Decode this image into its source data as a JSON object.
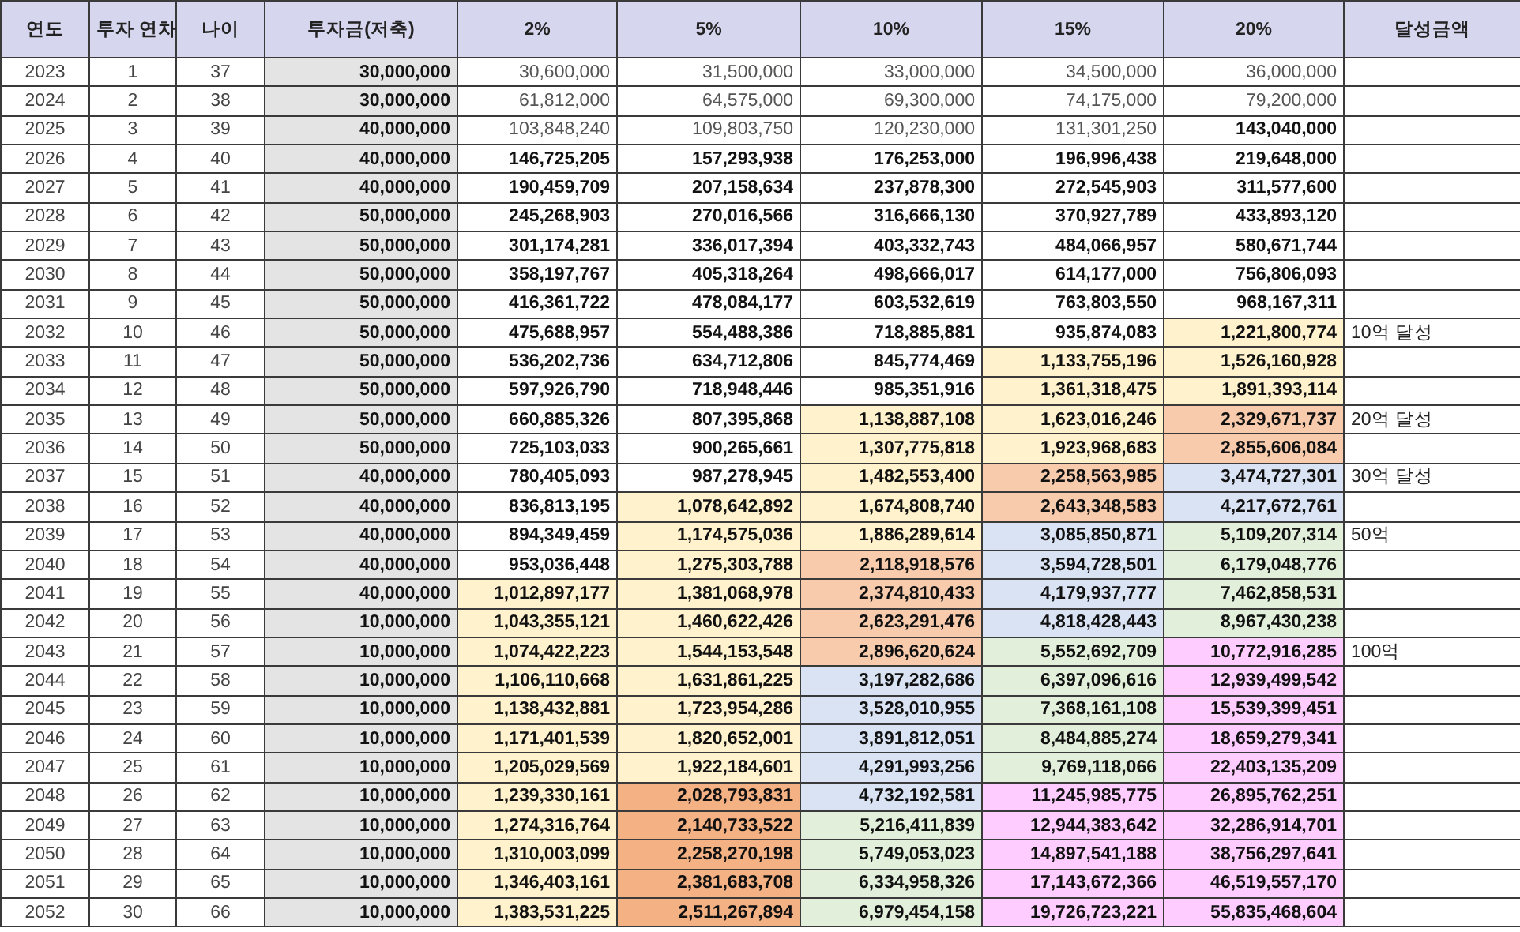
{
  "columns": [
    "연도",
    "투자 연차",
    "나이",
    "투자금(저축)",
    "2%",
    "5%",
    "10%",
    "15%",
    "20%",
    "달성금액"
  ],
  "rows": [
    {
      "year": "2023",
      "period": "1",
      "age": "37",
      "investment": "30,000,000",
      "rates": [
        {
          "text": "30,600,000",
          "muted": true
        },
        {
          "text": "31,500,000",
          "muted": true
        },
        {
          "text": "33,000,000",
          "muted": true
        },
        {
          "text": "34,500,000",
          "muted": true
        },
        {
          "text": "36,000,000",
          "muted": true
        }
      ]
    },
    {
      "year": "2024",
      "period": "2",
      "age": "38",
      "investment": "30,000,000",
      "rates": [
        {
          "text": "61,812,000",
          "muted": true
        },
        {
          "text": "64,575,000",
          "muted": true
        },
        {
          "text": "69,300,000",
          "muted": true
        },
        {
          "text": "74,175,000",
          "muted": true
        },
        {
          "text": "79,200,000",
          "muted": true
        }
      ]
    },
    {
      "year": "2025",
      "period": "3",
      "age": "39",
      "investment": "40,000,000",
      "rates": [
        {
          "text": "103,848,240",
          "muted": true
        },
        {
          "text": "109,803,750",
          "muted": true
        },
        {
          "text": "120,230,000",
          "muted": true
        },
        {
          "text": "131,301,250",
          "muted": true
        },
        {
          "text": "143,040,000",
          "muted": false
        }
      ]
    },
    {
      "year": "2026",
      "period": "4",
      "age": "40",
      "investment": "40,000,000",
      "rates": [
        {
          "text": "146,725,205",
          "muted": false
        },
        {
          "text": "157,293,938",
          "muted": false
        },
        {
          "text": "176,253,000",
          "muted": false
        },
        {
          "text": "196,996,438",
          "muted": false
        },
        {
          "text": "219,648,000",
          "muted": false
        }
      ]
    },
    {
      "year": "2027",
      "period": "5",
      "age": "41",
      "investment": "40,000,000",
      "rates": [
        {
          "text": "190,459,709",
          "muted": false
        },
        {
          "text": "207,158,634",
          "muted": false
        },
        {
          "text": "237,878,300",
          "muted": false
        },
        {
          "text": "272,545,903",
          "muted": false
        },
        {
          "text": "311,577,600",
          "muted": false
        }
      ]
    },
    {
      "year": "2028",
      "period": "6",
      "age": "42",
      "investment": "50,000,000",
      "rates": [
        {
          "text": "245,268,903",
          "muted": false
        },
        {
          "text": "270,016,566",
          "muted": false
        },
        {
          "text": "316,666,130",
          "muted": false
        },
        {
          "text": "370,927,789",
          "muted": false
        },
        {
          "text": "433,893,120",
          "muted": false
        }
      ]
    },
    {
      "year": "2029",
      "period": "7",
      "age": "43",
      "investment": "50,000,000",
      "rates": [
        {
          "text": "301,174,281",
          "muted": false
        },
        {
          "text": "336,017,394",
          "muted": false
        },
        {
          "text": "403,332,743",
          "muted": false
        },
        {
          "text": "484,066,957",
          "muted": false
        },
        {
          "text": "580,671,744",
          "muted": false
        }
      ]
    },
    {
      "year": "2030",
      "period": "8",
      "age": "44",
      "investment": "50,000,000",
      "rates": [
        {
          "text": "358,197,767",
          "muted": false
        },
        {
          "text": "405,318,264",
          "muted": false
        },
        {
          "text": "498,666,017",
          "muted": false
        },
        {
          "text": "614,177,000",
          "muted": false
        },
        {
          "text": "756,806,093",
          "muted": false
        }
      ]
    },
    {
      "year": "2031",
      "period": "9",
      "age": "45",
      "investment": "50,000,000",
      "rates": [
        {
          "text": "416,361,722",
          "muted": false
        },
        {
          "text": "478,084,177",
          "muted": false
        },
        {
          "text": "603,532,619",
          "muted": false
        },
        {
          "text": "763,803,550",
          "muted": false
        },
        {
          "text": "968,167,311",
          "muted": false
        }
      ]
    },
    {
      "year": "2032",
      "period": "10",
      "age": "46",
      "investment": "50,000,000",
      "rates": [
        {
          "text": "475,688,957",
          "muted": false
        },
        {
          "text": "554,488,386",
          "muted": false
        },
        {
          "text": "718,885,881",
          "muted": false
        },
        {
          "text": "935,874,083",
          "muted": false
        },
        {
          "text": "1,221,800,774",
          "muted": false,
          "color": "#fff2cc"
        }
      ],
      "note": "10억 달성"
    },
    {
      "year": "2033",
      "period": "11",
      "age": "47",
      "investment": "50,000,000",
      "rates": [
        {
          "text": "536,202,736",
          "muted": false
        },
        {
          "text": "634,712,806",
          "muted": false
        },
        {
          "text": "845,774,469",
          "muted": false
        },
        {
          "text": "1,133,755,196",
          "muted": false,
          "color": "#fff2cc"
        },
        {
          "text": "1,526,160,928",
          "muted": false,
          "color": "#fff2cc"
        }
      ]
    },
    {
      "year": "2034",
      "period": "12",
      "age": "48",
      "investment": "50,000,000",
      "rates": [
        {
          "text": "597,926,790",
          "muted": false
        },
        {
          "text": "718,948,446",
          "muted": false
        },
        {
          "text": "985,351,916",
          "muted": false
        },
        {
          "text": "1,361,318,475",
          "muted": false,
          "color": "#fff2cc"
        },
        {
          "text": "1,891,393,114",
          "muted": false,
          "color": "#fff2cc"
        }
      ]
    },
    {
      "year": "2035",
      "period": "13",
      "age": "49",
      "investment": "50,000,000",
      "rates": [
        {
          "text": "660,885,326",
          "muted": false
        },
        {
          "text": "807,395,868",
          "muted": false
        },
        {
          "text": "1,138,887,108",
          "muted": false,
          "color": "#fff2cc"
        },
        {
          "text": "1,623,016,246",
          "muted": false,
          "color": "#fff2cc"
        },
        {
          "text": "2,329,671,737",
          "muted": false,
          "color": "#f8cbad"
        }
      ],
      "note": "20억 달성"
    },
    {
      "year": "2036",
      "period": "14",
      "age": "50",
      "investment": "50,000,000",
      "rates": [
        {
          "text": "725,103,033",
          "muted": false
        },
        {
          "text": "900,265,661",
          "muted": false
        },
        {
          "text": "1,307,775,818",
          "muted": false,
          "color": "#fff2cc"
        },
        {
          "text": "1,923,968,683",
          "muted": false,
          "color": "#fff2cc"
        },
        {
          "text": "2,855,606,084",
          "muted": false,
          "color": "#f8cbad"
        }
      ]
    },
    {
      "year": "2037",
      "period": "15",
      "age": "51",
      "investment": "40,000,000",
      "rates": [
        {
          "text": "780,405,093",
          "muted": false
        },
        {
          "text": "987,278,945",
          "muted": false
        },
        {
          "text": "1,482,553,400",
          "muted": false,
          "color": "#fff2cc"
        },
        {
          "text": "2,258,563,985",
          "muted": false,
          "color": "#f8cbad"
        },
        {
          "text": "3,474,727,301",
          "muted": false,
          "color": "#dae3f3"
        }
      ],
      "note": "30억 달성"
    },
    {
      "year": "2038",
      "period": "16",
      "age": "52",
      "investment": "40,000,000",
      "rates": [
        {
          "text": "836,813,195",
          "muted": false
        },
        {
          "text": "1,078,642,892",
          "muted": false,
          "color": "#fff2cc"
        },
        {
          "text": "1,674,808,740",
          "muted": false,
          "color": "#fff2cc"
        },
        {
          "text": "2,643,348,583",
          "muted": false,
          "color": "#f8cbad"
        },
        {
          "text": "4,217,672,761",
          "muted": false,
          "color": "#dae3f3"
        }
      ]
    },
    {
      "year": "2039",
      "period": "17",
      "age": "53",
      "investment": "40,000,000",
      "rates": [
        {
          "text": "894,349,459",
          "muted": false
        },
        {
          "text": "1,174,575,036",
          "muted": false,
          "color": "#fff2cc"
        },
        {
          "text": "1,886,289,614",
          "muted": false,
          "color": "#fff2cc"
        },
        {
          "text": "3,085,850,871",
          "muted": false,
          "color": "#dae3f3"
        },
        {
          "text": "5,109,207,314",
          "muted": false,
          "color": "#e2efda"
        }
      ],
      "note": "50억"
    },
    {
      "year": "2040",
      "period": "18",
      "age": "54",
      "investment": "40,000,000",
      "rates": [
        {
          "text": "953,036,448",
          "muted": false
        },
        {
          "text": "1,275,303,788",
          "muted": false,
          "color": "#fff2cc"
        },
        {
          "text": "2,118,918,576",
          "muted": false,
          "color": "#f8cbad"
        },
        {
          "text": "3,594,728,501",
          "muted": false,
          "color": "#dae3f3"
        },
        {
          "text": "6,179,048,776",
          "muted": false,
          "color": "#e2efda"
        }
      ]
    },
    {
      "year": "2041",
      "period": "19",
      "age": "55",
      "investment": "40,000,000",
      "rates": [
        {
          "text": "1,012,897,177",
          "muted": false,
          "color": "#fff2cc"
        },
        {
          "text": "1,381,068,978",
          "muted": false,
          "color": "#fff2cc"
        },
        {
          "text": "2,374,810,433",
          "muted": false,
          "color": "#f8cbad"
        },
        {
          "text": "4,179,937,777",
          "muted": false,
          "color": "#dae3f3"
        },
        {
          "text": "7,462,858,531",
          "muted": false,
          "color": "#e2efda"
        }
      ]
    },
    {
      "year": "2042",
      "period": "20",
      "age": "56",
      "investment": "10,000,000",
      "rates": [
        {
          "text": "1,043,355,121",
          "muted": false,
          "color": "#fff2cc"
        },
        {
          "text": "1,460,622,426",
          "muted": false,
          "color": "#fff2cc"
        },
        {
          "text": "2,623,291,476",
          "muted": false,
          "color": "#f8cbad"
        },
        {
          "text": "4,818,428,443",
          "muted": false,
          "color": "#dae3f3"
        },
        {
          "text": "8,967,430,238",
          "muted": false,
          "color": "#e2efda"
        }
      ]
    },
    {
      "year": "2043",
      "period": "21",
      "age": "57",
      "investment": "10,000,000",
      "rates": [
        {
          "text": "1,074,422,223",
          "muted": false,
          "color": "#fff2cc"
        },
        {
          "text": "1,544,153,548",
          "muted": false,
          "color": "#fff2cc"
        },
        {
          "text": "2,896,620,624",
          "muted": false,
          "color": "#f8cbad"
        },
        {
          "text": "5,552,692,709",
          "muted": false,
          "color": "#e2efda"
        },
        {
          "text": "10,772,916,285",
          "muted": false,
          "color": "#ffccff"
        }
      ],
      "note": "100억"
    },
    {
      "year": "2044",
      "period": "22",
      "age": "58",
      "investment": "10,000,000",
      "rates": [
        {
          "text": "1,106,110,668",
          "muted": false,
          "color": "#fff2cc"
        },
        {
          "text": "1,631,861,225",
          "muted": false,
          "color": "#fff2cc"
        },
        {
          "text": "3,197,282,686",
          "muted": false,
          "color": "#dae3f3"
        },
        {
          "text": "6,397,096,616",
          "muted": false,
          "color": "#e2efda"
        },
        {
          "text": "12,939,499,542",
          "muted": false,
          "color": "#ffccff"
        }
      ]
    },
    {
      "year": "2045",
      "period": "23",
      "age": "59",
      "investment": "10,000,000",
      "rates": [
        {
          "text": "1,138,432,881",
          "muted": false,
          "color": "#fff2cc"
        },
        {
          "text": "1,723,954,286",
          "muted": false,
          "color": "#fff2cc"
        },
        {
          "text": "3,528,010,955",
          "muted": false,
          "color": "#dae3f3"
        },
        {
          "text": "7,368,161,108",
          "muted": false,
          "color": "#e2efda"
        },
        {
          "text": "15,539,399,451",
          "muted": false,
          "color": "#ffccff"
        }
      ]
    },
    {
      "year": "2046",
      "period": "24",
      "age": "60",
      "investment": "10,000,000",
      "rates": [
        {
          "text": "1,171,401,539",
          "muted": false,
          "color": "#fff2cc"
        },
        {
          "text": "1,820,652,001",
          "muted": false,
          "color": "#fff2cc"
        },
        {
          "text": "3,891,812,051",
          "muted": false,
          "color": "#dae3f3"
        },
        {
          "text": "8,484,885,274",
          "muted": false,
          "color": "#e2efda"
        },
        {
          "text": "18,659,279,341",
          "muted": false,
          "color": "#ffccff"
        }
      ]
    },
    {
      "year": "2047",
      "period": "25",
      "age": "61",
      "investment": "10,000,000",
      "rates": [
        {
          "text": "1,205,029,569",
          "muted": false,
          "color": "#fff2cc"
        },
        {
          "text": "1,922,184,601",
          "muted": false,
          "color": "#fff2cc"
        },
        {
          "text": "4,291,993,256",
          "muted": false,
          "color": "#dae3f3"
        },
        {
          "text": "9,769,118,066",
          "muted": false,
          "color": "#e2efda"
        },
        {
          "text": "22,403,135,209",
          "muted": false,
          "color": "#ffccff"
        }
      ]
    },
    {
      "year": "2048",
      "period": "26",
      "age": "62",
      "investment": "10,000,000",
      "rates": [
        {
          "text": "1,239,330,161",
          "muted": false,
          "color": "#fff2cc"
        },
        {
          "text": "2,028,793,831",
          "muted": false,
          "color": "#f4b183"
        },
        {
          "text": "4,732,192,581",
          "muted": false,
          "color": "#dae3f3"
        },
        {
          "text": "11,245,985,775",
          "muted": false,
          "color": "#ffccff"
        },
        {
          "text": "26,895,762,251",
          "muted": false,
          "color": "#ffccff"
        }
      ]
    },
    {
      "year": "2049",
      "period": "27",
      "age": "63",
      "investment": "10,000,000",
      "rates": [
        {
          "text": "1,274,316,764",
          "muted": false,
          "color": "#fff2cc"
        },
        {
          "text": "2,140,733,522",
          "muted": false,
          "color": "#f4b183"
        },
        {
          "text": "5,216,411,839",
          "muted": false,
          "color": "#e2efda"
        },
        {
          "text": "12,944,383,642",
          "muted": false,
          "color": "#ffccff"
        },
        {
          "text": "32,286,914,701",
          "muted": false,
          "color": "#ffccff"
        }
      ]
    },
    {
      "year": "2050",
      "period": "28",
      "age": "64",
      "investment": "10,000,000",
      "rates": [
        {
          "text": "1,310,003,099",
          "muted": false,
          "color": "#fff2cc"
        },
        {
          "text": "2,258,270,198",
          "muted": false,
          "color": "#f4b183"
        },
        {
          "text": "5,749,053,023",
          "muted": false,
          "color": "#e2efda"
        },
        {
          "text": "14,897,541,188",
          "muted": false,
          "color": "#ffccff"
        },
        {
          "text": "38,756,297,641",
          "muted": false,
          "color": "#ffccff"
        }
      ]
    },
    {
      "year": "2051",
      "period": "29",
      "age": "65",
      "investment": "10,000,000",
      "rates": [
        {
          "text": "1,346,403,161",
          "muted": false,
          "color": "#fff2cc"
        },
        {
          "text": "2,381,683,708",
          "muted": false,
          "color": "#f4b183"
        },
        {
          "text": "6,334,958,326",
          "muted": false,
          "color": "#e2efda"
        },
        {
          "text": "17,143,672,366",
          "muted": false,
          "color": "#ffccff"
        },
        {
          "text": "46,519,557,170",
          "muted": false,
          "color": "#ffccff"
        }
      ]
    },
    {
      "year": "2052",
      "period": "30",
      "age": "66",
      "investment": "10,000,000",
      "rates": [
        {
          "text": "1,383,531,225",
          "muted": false,
          "color": "#fff2cc"
        },
        {
          "text": "2,511,267,894",
          "muted": false,
          "color": "#f4b183"
        },
        {
          "text": "6,979,454,158",
          "muted": false,
          "color": "#e2efda"
        },
        {
          "text": "19,726,723,221",
          "muted": false,
          "color": "#ffccff"
        },
        {
          "text": "55,835,468,604",
          "muted": false,
          "color": "#ffccff"
        }
      ]
    }
  ]
}
